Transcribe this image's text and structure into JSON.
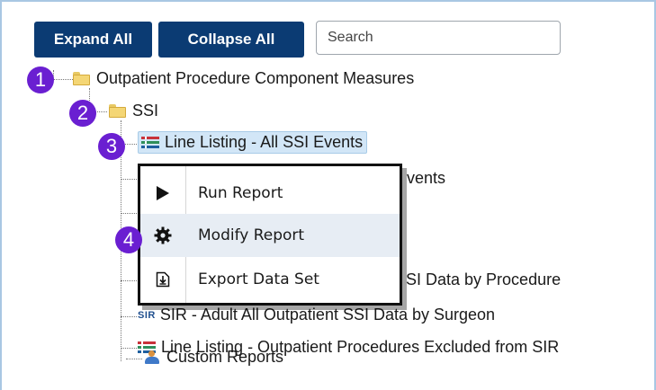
{
  "toolbar": {
    "expand_label": "Expand All",
    "collapse_label": "Collapse All",
    "search_placeholder": "Search"
  },
  "tree": {
    "root_label": "Outpatient Procedure Component Measures",
    "ssi_label": "SSI",
    "items": [
      {
        "label": "Line Listing - All SSI Events",
        "icon": "line-listing-icon",
        "selected": true
      },
      {
        "label": "vents",
        "icon": "line-listing-icon"
      },
      {
        "label": "SI Data by Procedure",
        "icon": "sir-icon"
      },
      {
        "label": "SIR - Adult All Outpatient SSI Data by Surgeon",
        "icon": "sir-icon"
      },
      {
        "label": "Line Listing - Outpatient Procedures Excluded from SIR",
        "icon": "line-listing-icon"
      },
      {
        "label": "Custom Reports",
        "icon": "people-icon"
      }
    ],
    "sir_icon_text": "SIR"
  },
  "context_menu": {
    "items": [
      {
        "label": "Run Report",
        "icon": "play-icon"
      },
      {
        "label": "Modify Report",
        "icon": "gear-icon",
        "hovered": true
      },
      {
        "label": "Export Data Set",
        "icon": "export-icon"
      }
    ]
  },
  "badges": [
    "1",
    "2",
    "3",
    "4"
  ],
  "colors": {
    "button_bg": "#0b3b73",
    "badge_bg": "#6a1fd1",
    "selection_bg": "#d2e6f7"
  }
}
